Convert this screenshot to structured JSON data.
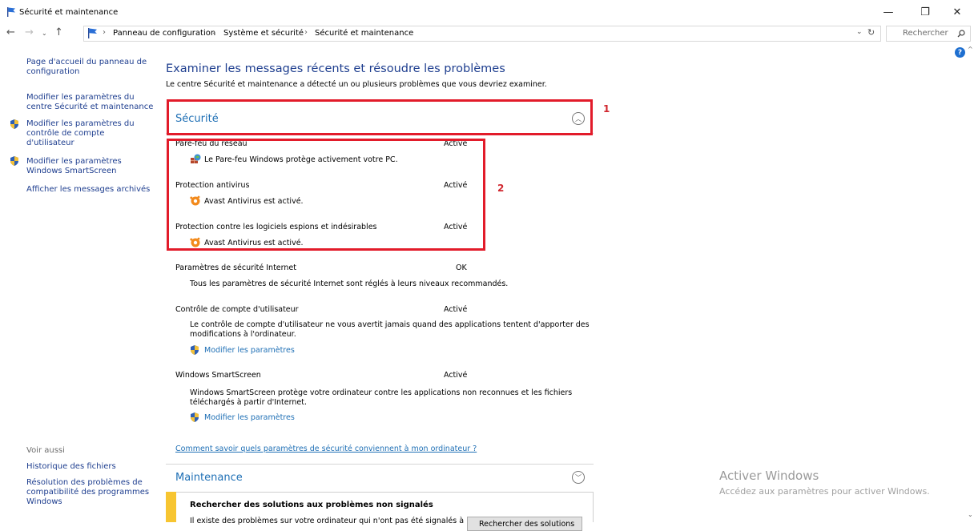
{
  "window": {
    "title": "Sécurité et maintenance"
  },
  "address": {
    "crumbs": [
      "Panneau de configuration",
      "Système et sécurité",
      "Sécurité et maintenance"
    ],
    "search_placeholder": "Rechercher"
  },
  "sidebar": {
    "home_link": [
      "Page d'accueil du panneau de",
      "configuration"
    ],
    "items": [
      {
        "lines": [
          "Modifier les paramètres du",
          "centre Sécurité et maintenance"
        ]
      },
      {
        "lines": [
          "Modifier les paramètres du",
          "contrôle de compte",
          "d'utilisateur"
        ]
      },
      {
        "lines": [
          "Modifier les paramètres",
          "Windows SmartScreen"
        ]
      },
      {
        "lines": [
          "Afficher les messages archivés"
        ]
      }
    ],
    "see_also": "Voir aussi",
    "see_also_links": [
      {
        "lines": [
          "Historique des fichiers"
        ]
      },
      {
        "lines": [
          "Résolution des problèmes de",
          "compatibilité des programmes",
          "Windows"
        ]
      }
    ]
  },
  "main": {
    "heading": "Examiner les messages récents et résoudre les problèmes",
    "description": "Le centre Sécurité et maintenance a détecté un ou plusieurs problèmes que vous devriez examiner.",
    "security": {
      "title": "Sécurité",
      "items": [
        {
          "label": "Pare-feu du réseau",
          "status": "Activé",
          "desc": "Le Pare-feu Windows protège activement votre PC."
        },
        {
          "label": "Protection antivirus",
          "status": "Activé",
          "desc": "Avast Antivirus est activé."
        },
        {
          "label": "Protection contre les logiciels espions et indésirables",
          "status": "Activé",
          "desc": "Avast Antivirus est activé."
        },
        {
          "label": "Paramètres de sécurité Internet",
          "status": "OK",
          "desc": "Tous les paramètres de sécurité Internet sont réglés à leurs niveaux recommandés."
        },
        {
          "label": "Contrôle de compte d'utilisateur",
          "status": "Activé",
          "desc_lines": [
            "Le contrôle de compte d'utilisateur ne vous avertit jamais quand des applications tentent d'apporter des",
            "modifications à l'ordinateur."
          ],
          "link": "Modifier les paramètres"
        },
        {
          "label": "Windows SmartScreen",
          "status": "Activé",
          "desc_lines": [
            "Windows SmartScreen protège votre ordinateur contre les applications non reconnues et les fichiers",
            "téléchargés à partir d'Internet."
          ],
          "link": "Modifier les paramètres"
        }
      ],
      "help_link": "Comment savoir quels paramètres de sécurité conviennent à mon ordinateur ?"
    },
    "maintenance": {
      "title": "Maintenance",
      "alert_title": "Rechercher des solutions aux problèmes non signalés",
      "alert_text": "Il existe des problèmes sur votre ordinateur qui n'ont pas été signalés à",
      "alert_button": "Rechercher des solutions"
    }
  },
  "annotations": {
    "box1": "1",
    "box2": "2"
  },
  "watermark": {
    "line1": "Activer Windows",
    "line2": "Accédez aux paramètres pour activer Windows."
  },
  "colors": {
    "link_blue": "#1e6fb5",
    "heading_blue": "#1e3e8f",
    "annotation_red": "#e21b2a",
    "maintenance_yellow": "#f7c531"
  }
}
